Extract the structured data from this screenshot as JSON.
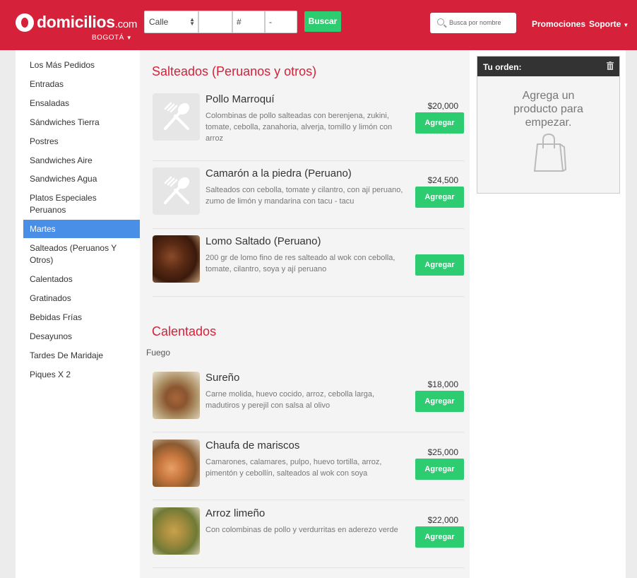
{
  "header": {
    "logo_text": "domicilios",
    "logo_suffix": ".com",
    "city": "BOGOTÁ",
    "address": {
      "street_type": "Calle",
      "number_placeholder": "#",
      "dash_placeholder": "-"
    },
    "search_button": "Buscar",
    "search_placeholder": "Busca por nombre",
    "nav": {
      "promos": "Promociones",
      "soporte": "Soporte"
    }
  },
  "sidebar": {
    "items": [
      {
        "label": "Los Más Pedidos"
      },
      {
        "label": "Entradas"
      },
      {
        "label": "Ensaladas"
      },
      {
        "label": "Sándwiches Tierra"
      },
      {
        "label": "Postres"
      },
      {
        "label": "Sandwiches Aire"
      },
      {
        "label": "Sandwiches Agua"
      },
      {
        "label": "Platos Especiales Peruanos"
      },
      {
        "label": "Martes"
      },
      {
        "label": "Salteados (Peruanos Y Otros)"
      },
      {
        "label": "Calentados"
      },
      {
        "label": "Gratinados"
      },
      {
        "label": "Bebidas Frías"
      },
      {
        "label": "Desayunos"
      },
      {
        "label": "Tardes De Maridaje"
      },
      {
        "label": "Piques X 2"
      }
    ]
  },
  "sections": [
    {
      "title": "Salteados (Peruanos y otros)",
      "items": [
        {
          "name": "Pollo Marroquí",
          "desc": "Colombinas de pollo salteadas con berenjena, zukini, tomate, cebolla, zanahoria, alverja, tomillo y limón con arroz",
          "price": "$20,000",
          "button": "Agregar"
        },
        {
          "name": "Camarón a la piedra (Peruano)",
          "desc": "Salteados con cebolla, tomate y cilantro, con ají peruano, zumo de limón y mandarina con tacu - tacu",
          "price": "$24,500",
          "button": "Agregar"
        },
        {
          "name": "Lomo Saltado (Peruano)",
          "desc": "200 gr de lomo fino de res salteado al wok con cebolla, tomate, cilantro, soya y ají peruano",
          "price": "",
          "button": "Agregar"
        }
      ]
    },
    {
      "title": "Calentados",
      "subtitle": "Fuego",
      "items": [
        {
          "name": "Sureño",
          "desc": "Carne molida, huevo cocido, arroz, cebolla larga, madutiros y perejil con salsa al olivo",
          "price": "$18,000",
          "button": "Agregar"
        },
        {
          "name": "Chaufa de mariscos",
          "desc": "Camarones, calamares, pulpo, huevo tortilla, arroz, pimentón y cebollín, salteados al wok con soya",
          "price": "$25,000",
          "button": "Agregar"
        },
        {
          "name": "Arroz limeño",
          "desc": "Con colombinas de pollo y verdurritas en aderezo verde",
          "price": "$22,000",
          "button": "Agregar"
        }
      ]
    }
  ],
  "order": {
    "title": "Tu orden:",
    "empty_line1": "Agrega un",
    "empty_line2": "producto para",
    "empty_line3": "empezar."
  },
  "colors": {
    "brand": "#d5213a",
    "accent_green": "#2ecc71",
    "active_blue": "#4a8fe7"
  }
}
